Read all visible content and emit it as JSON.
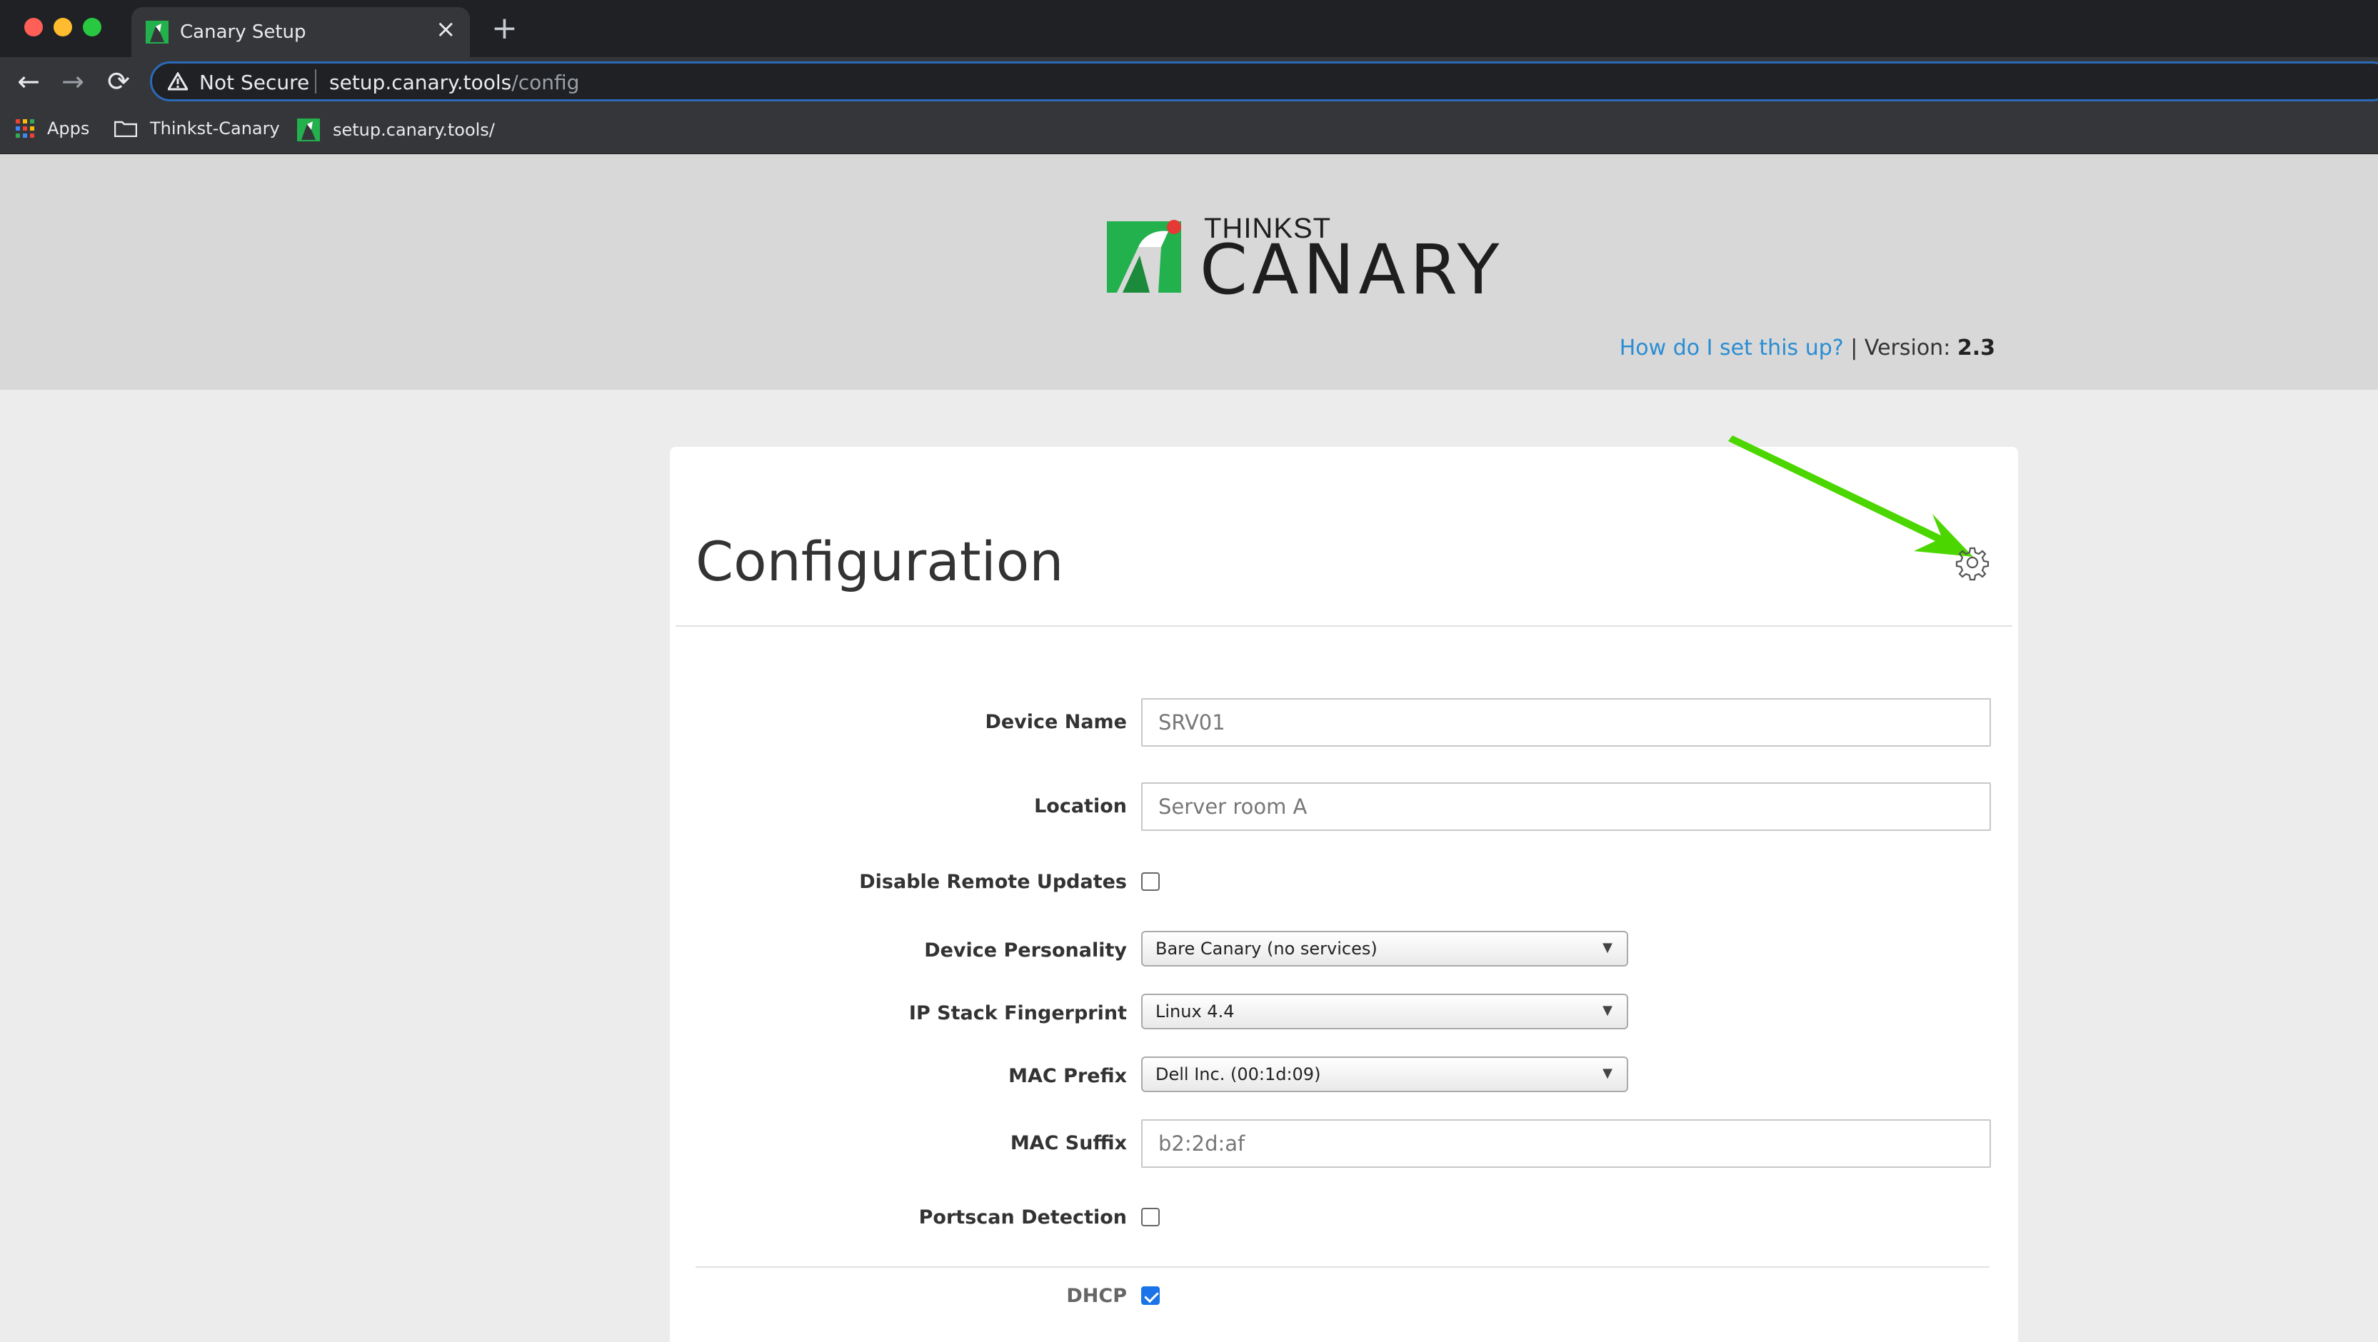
{
  "browser": {
    "tab_title": "Canary Setup",
    "tab_close": "×",
    "new_tab": "+",
    "nav_back": "←",
    "nav_forward": "→",
    "nav_reload": "⟳",
    "security_label": "Not Secure",
    "url_host": "setup.canary.tools",
    "url_path": "/config",
    "bookmarks": [
      {
        "label": "Apps",
        "icon": "apps-grid-icon"
      },
      {
        "label": "Thinkst-Canary",
        "icon": "folder-icon"
      },
      {
        "label": "setup.canary.tools/",
        "icon": "canary-favicon"
      }
    ]
  },
  "header": {
    "logo_small": "THINKST",
    "logo_large": "CANARY",
    "help_link": "How do I set this up?",
    "separator": " | ",
    "version_label": "Version: ",
    "version_value": "2.3"
  },
  "config": {
    "title": "Configuration",
    "settings_icon": "gear-icon",
    "fields": {
      "device_name": {
        "label": "Device Name",
        "value": "SRV01"
      },
      "location": {
        "label": "Location",
        "value": "Server room A"
      },
      "disable_remote_updates": {
        "label": "Disable Remote Updates",
        "checked": false
      },
      "device_personality": {
        "label": "Device Personality",
        "value": "Bare Canary (no services)"
      },
      "ip_stack_fingerprint": {
        "label": "IP Stack Fingerprint",
        "value": "Linux 4.4"
      },
      "mac_prefix": {
        "label": "MAC Prefix",
        "value": "Dell Inc. (00:1d:09)"
      },
      "mac_suffix": {
        "label": "MAC Suffix",
        "value": "b2:2d:af"
      },
      "portscan_detection": {
        "label": "Portscan Detection",
        "checked": false
      },
      "dhcp": {
        "label": "DHCP",
        "checked": true
      }
    }
  },
  "colors": {
    "accent_link": "#2a8dd4",
    "brand_green": "#22b14c",
    "brand_red": "#e53935",
    "annotation_arrow": "#4cd600",
    "checkbox_checked": "#1a73e8"
  }
}
